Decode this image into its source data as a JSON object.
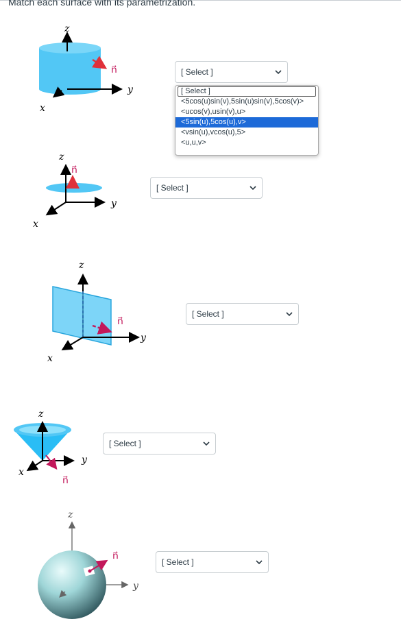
{
  "instructions": "Match each surface with its parametrization.",
  "axis_labels": {
    "x": "x",
    "y": "y",
    "z": "z",
    "normal": "n⃗"
  },
  "selects": [
    {
      "value": "[ Select ]",
      "expanded": true
    },
    {
      "value": "[ Select ]"
    },
    {
      "value": "[ Select ]"
    },
    {
      "value": "[ Select ]"
    },
    {
      "value": "[ Select ]"
    }
  ],
  "dropdown_options": [
    "[ Select ]",
    "<5cos(u)sin(v),5sin(u)sin(v),5cos(v)>",
    "<ucos(v),usin(v),u>",
    "<5sin(u),5cos(u),v>",
    "<vsin(u),vcos(u),5>",
    "<u,u,v>"
  ],
  "dropdown_highlighted_index": 3,
  "colors": {
    "surface_blue": "#52c7f5",
    "normal_red": "#e0313a",
    "normal_magenta": "#c2185b",
    "highlight": "#1d6ad8"
  }
}
